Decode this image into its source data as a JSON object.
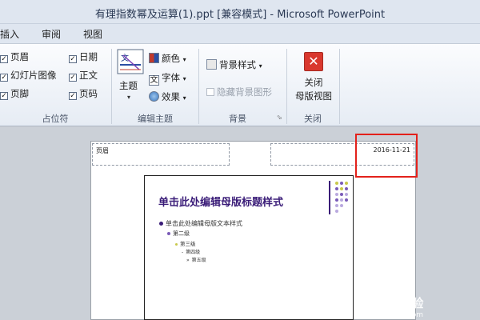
{
  "window": {
    "title": "有理指数幂及运算(1).ppt [兼容模式] - Microsoft PowerPoint"
  },
  "tabs": [
    "插入",
    "审阅",
    "视图"
  ],
  "ribbon": {
    "placeholders_group": {
      "label": "占位符",
      "items": [
        {
          "label": "页眉",
          "checked": true
        },
        {
          "label": "幻灯片图像",
          "checked": true
        },
        {
          "label": "页脚",
          "checked": true
        },
        {
          "label": "日期",
          "checked": true
        },
        {
          "label": "正文",
          "checked": true
        },
        {
          "label": "页码",
          "checked": true
        }
      ]
    },
    "theme_group": {
      "label": "编辑主题",
      "theme_button": "主题",
      "colors": "颜色",
      "fonts": "字体",
      "effects": "效果"
    },
    "background_group": {
      "label": "背景",
      "bg_styles": "背景样式",
      "hide_bg": "隐藏背景图形"
    },
    "close_group": {
      "label": "关闭",
      "close_line1": "关闭",
      "close_line2": "母版视图"
    }
  },
  "notes_page": {
    "header_placeholder": "页眉",
    "date_placeholder": "2016-11-21",
    "slide": {
      "title": "单击此处编辑母版标题样式",
      "level1": "单击此处编辑母版文本样式",
      "level2": "第二级",
      "level3": "第三级",
      "level4": "第四级",
      "level5": "第五级"
    }
  },
  "watermark": {
    "text": "jingyan.baidu.com"
  },
  "colors": {
    "title": "#3a1c78",
    "highlight": "#e3211b",
    "close_icon": "#d9382e"
  }
}
